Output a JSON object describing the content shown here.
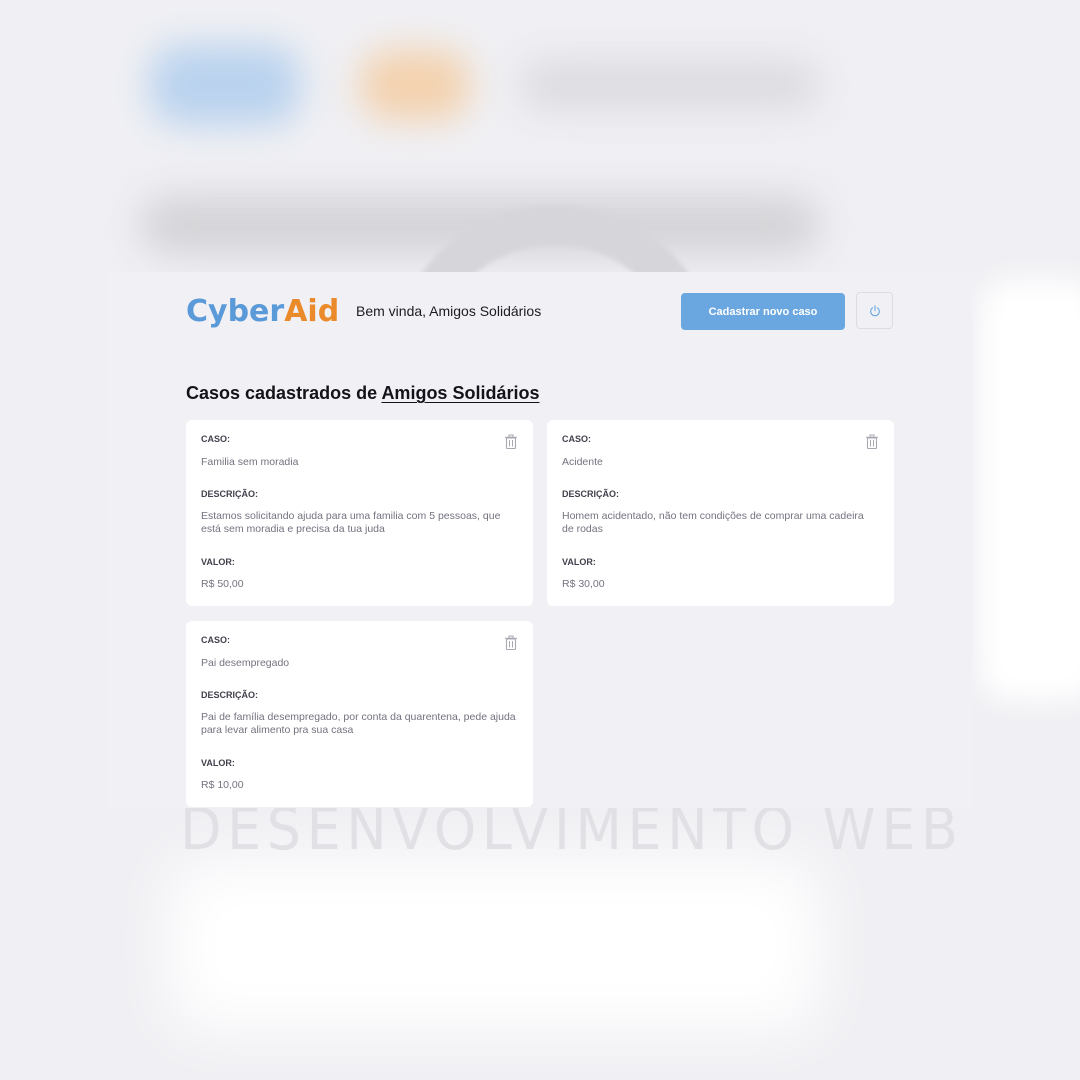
{
  "header": {
    "logo_part1": "Cyber",
    "logo_part2": "Aid",
    "welcome": "Bem vinda, Amigos Solidários",
    "new_case_label": "Cadastrar novo caso"
  },
  "page": {
    "title_prefix": "Casos cadastrados de",
    "title_org": "Amigos Solidários"
  },
  "labels": {
    "case": "CASO:",
    "description": "DESCRIÇÃO:",
    "value": "VALOR:"
  },
  "cases": [
    {
      "title": "Familia sem moradia",
      "description": "Estamos solicitando ajuda para uma familia com 5 pessoas, que está sem moradia e precisa da tua juda",
      "value": "R$ 50,00"
    },
    {
      "title": "Acidente",
      "description": "Homem acidentado, não tem condições de comprar uma cadeira de rodas",
      "value": "R$ 30,00"
    },
    {
      "title": "Pai desempregado",
      "description": "Pai de família desempregado, por conta da quarentena, pede ajuda para levar alimento pra sua casa",
      "value": "R$ 10,00"
    }
  ],
  "watermark": "DESENVOLVIMENTO WEB",
  "colors": {
    "primary": "#6aa7e0",
    "logo_blue": "#5b9ad8",
    "logo_orange": "#ea8a2b",
    "background": "#f0f0f5"
  },
  "icons": {
    "logout": "power-icon",
    "delete": "trash-icon"
  }
}
